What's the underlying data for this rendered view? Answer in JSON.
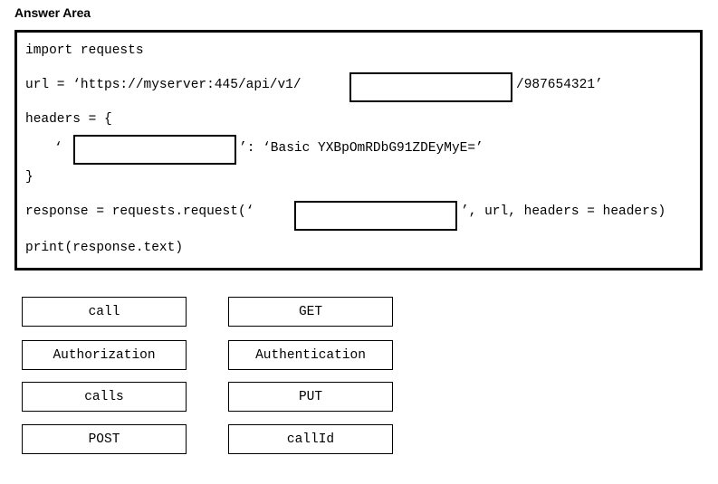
{
  "page": {
    "title": "Answer Area",
    "background_color": "#ffffff",
    "text_color": "#000000",
    "border_color": "#000000"
  },
  "code_block": {
    "language": "python",
    "lines": {
      "import": "import requests",
      "url_prefix": "url = ‘https://myserver:445/api/v1/",
      "url_suffix": "/987654321’",
      "headers_open": "headers = {",
      "header_quote_open": "‘",
      "header_value": "’: ‘Basic YXBpOmRDbG91ZDEyMyE=’",
      "brace_close": "}",
      "response_prefix": "response = requests.request(‘",
      "response_suffix": "’, url, headers = headers)",
      "print": "print(response.text)"
    }
  },
  "drop_targets": [
    {
      "name": "url-path-segment-blank",
      "value": "",
      "placeholder": ""
    },
    {
      "name": "header-key-blank",
      "value": "",
      "placeholder": ""
    },
    {
      "name": "http-method-blank",
      "value": "",
      "placeholder": ""
    }
  ],
  "options": {
    "left_column": [
      "call",
      "Authorization",
      "calls",
      "POST"
    ],
    "right_column": [
      "GET",
      "Authentication",
      "PUT",
      "callId"
    ]
  }
}
